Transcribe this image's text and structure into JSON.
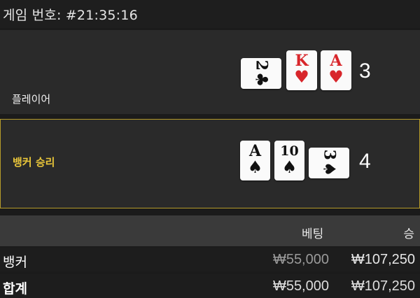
{
  "header": {
    "game_number": "게임 번호: #21:35:16"
  },
  "player": {
    "label": "플레이어",
    "score": "3",
    "cards": [
      {
        "rank": "2",
        "suit": "♣",
        "color": "black",
        "rotated": true
      },
      {
        "rank": "K",
        "suit": "♥",
        "color": "red",
        "rotated": false
      },
      {
        "rank": "A",
        "suit": "♥",
        "color": "red",
        "rotated": false
      }
    ]
  },
  "banker": {
    "label": "뱅커 승리",
    "score": "4",
    "cards": [
      {
        "rank": "A",
        "suit": "♠",
        "color": "black",
        "rotated": false
      },
      {
        "rank": "10",
        "suit": "♠",
        "color": "black",
        "rotated": false
      },
      {
        "rank": "3",
        "suit": "♠",
        "color": "black",
        "rotated": true
      }
    ]
  },
  "table": {
    "col_bet": "베팅",
    "col_win": "승",
    "rows": [
      {
        "label": "뱅커",
        "bet": "₩55,000",
        "win": "₩107,250"
      },
      {
        "label": "합계",
        "bet": "₩55,000",
        "win": "₩107,250"
      }
    ]
  },
  "colors": {
    "red_suit": "#d8262b",
    "banker_gold": "#e9c63a",
    "banker_border": "#b59a2a"
  }
}
